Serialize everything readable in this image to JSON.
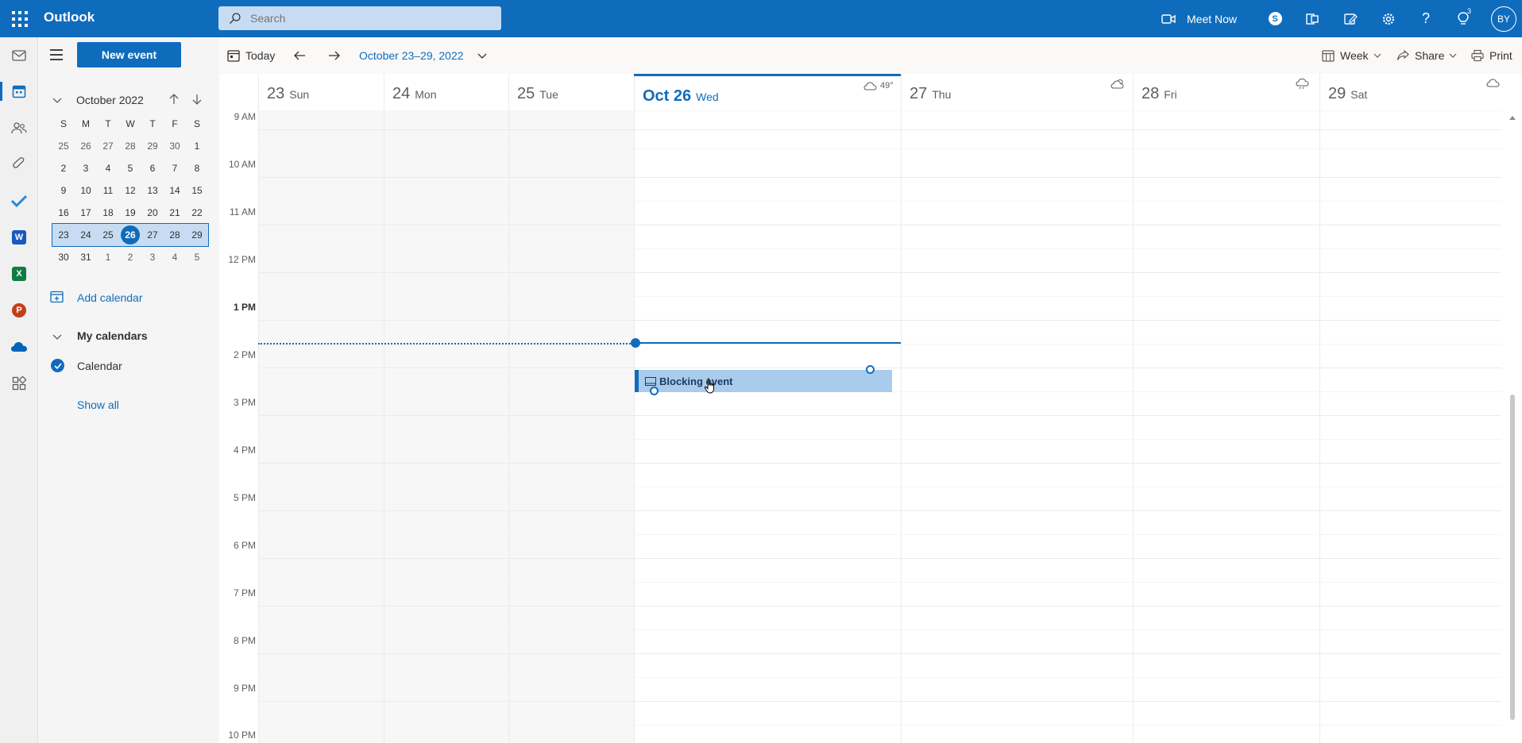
{
  "app": {
    "title": "Outlook"
  },
  "search": {
    "placeholder": "Search"
  },
  "topbar": {
    "meet_now": "Meet Now",
    "notification_count": "3",
    "avatar_initials": "BY"
  },
  "sidepane": {
    "new_event": "New event",
    "mini_calendar": {
      "month_label": "October 2022",
      "weekdays": [
        "S",
        "M",
        "T",
        "W",
        "T",
        "F",
        "S"
      ],
      "weeks": [
        [
          "25",
          "26",
          "27",
          "28",
          "29",
          "30",
          "1"
        ],
        [
          "2",
          "3",
          "4",
          "5",
          "6",
          "7",
          "8"
        ],
        [
          "9",
          "10",
          "11",
          "12",
          "13",
          "14",
          "15"
        ],
        [
          "16",
          "17",
          "18",
          "19",
          "20",
          "21",
          "22"
        ],
        [
          "23",
          "24",
          "25",
          "26",
          "27",
          "28",
          "29"
        ],
        [
          "30",
          "31",
          "1",
          "2",
          "3",
          "4",
          "5"
        ]
      ],
      "today": "26"
    },
    "add_calendar": "Add calendar",
    "my_calendars": "My calendars",
    "calendar_name": "Calendar",
    "show_all": "Show all"
  },
  "command_bar": {
    "today": "Today",
    "date_range": "October 23–29, 2022",
    "view": "Week",
    "share": "Share",
    "print": "Print"
  },
  "days": [
    {
      "num": "23",
      "name": "Sun"
    },
    {
      "num": "24",
      "name": "Mon"
    },
    {
      "num": "25",
      "name": "Tue"
    },
    {
      "num": "Oct 26",
      "name": "Wed",
      "weather": "49°"
    },
    {
      "num": "27",
      "name": "Thu"
    },
    {
      "num": "28",
      "name": "Fri"
    },
    {
      "num": "29",
      "name": "Sat"
    }
  ],
  "times": [
    "9 AM",
    "10 AM",
    "11 AM",
    "12 PM",
    "1 PM",
    "2 PM",
    "3 PM",
    "4 PM",
    "5 PM",
    "6 PM",
    "7 PM",
    "8 PM",
    "9 PM",
    "10 PM"
  ],
  "event": {
    "title": "Blocking event"
  },
  "colors": {
    "accent": "#0f6cbd",
    "event_fill": "#a9cbec"
  }
}
